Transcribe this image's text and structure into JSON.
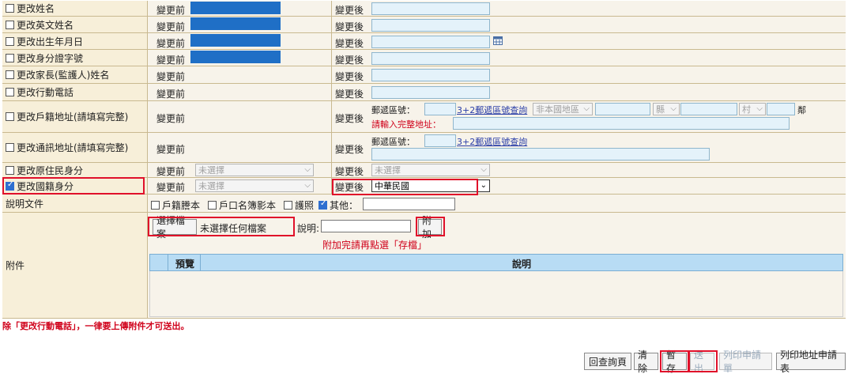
{
  "rows": [
    {
      "label": "更改姓名",
      "before": "變更前",
      "after": "變更後"
    },
    {
      "label": "更改英文姓名",
      "before": "變更前",
      "after": "變更後"
    },
    {
      "label": "更改出生年月日",
      "before": "變更前",
      "after": "變更後"
    },
    {
      "label": "更改身分證字號",
      "before": "變更前",
      "after": "變更後"
    },
    {
      "label": "更改家長(監護人)姓名",
      "before": "變更前",
      "after": "變更後"
    },
    {
      "label": "更改行動電話",
      "before": "變更前",
      "after": "變更後"
    },
    {
      "label": "更改戶籍地址(請填寫完整)",
      "before": "變更前",
      "after": "變更後"
    },
    {
      "label": "更改通訊地址(請填寫完整)",
      "before": "變更前",
      "after": "變更後"
    },
    {
      "label": "更改原住民身分",
      "before": "變更前",
      "after": "變更後"
    },
    {
      "label": "更改國籍身分",
      "before": "變更前",
      "after": "變更後"
    }
  ],
  "address": {
    "postal_label": "郵遞區號：",
    "postal_lookup": "3+2郵遞區號查詢",
    "area_placeholder": "非本國地區",
    "county_placeholder": "縣",
    "village_placeholder": "村",
    "neighbor_suffix": "鄰",
    "warning": "請輸入完整地址："
  },
  "indigenous": {
    "before_value": "未選擇",
    "after_value": "未選擇"
  },
  "nationality": {
    "before_value": "未選擇",
    "after_value": "中華民國",
    "checked": true
  },
  "documents": {
    "label": "說明文件",
    "options": [
      "戶籍謄本",
      "戶口名簿影本",
      "護照",
      "其他："
    ],
    "other_checked": true
  },
  "attachment": {
    "label": "附件",
    "choose_file": "選擇檔案",
    "no_file": "未選擇任何檔案",
    "desc_label": "說明:",
    "attach_btn": "附加",
    "hint": "附加完請再點選「存檔」",
    "col_preview": "預覽",
    "col_desc": "說明"
  },
  "footer_note": "除「更改行動電話」，一律要上傳附件才可送出。",
  "buttons": {
    "home": "回查詢頁",
    "clear": "清除",
    "save": "暫存",
    "submit": "送出",
    "print_form": "列印申請單",
    "print_address": "列印地址申請表"
  },
  "colors": {
    "highlight": "#e0102a",
    "mask": "#1f6fc6",
    "label_bg": "#f7efd9"
  }
}
